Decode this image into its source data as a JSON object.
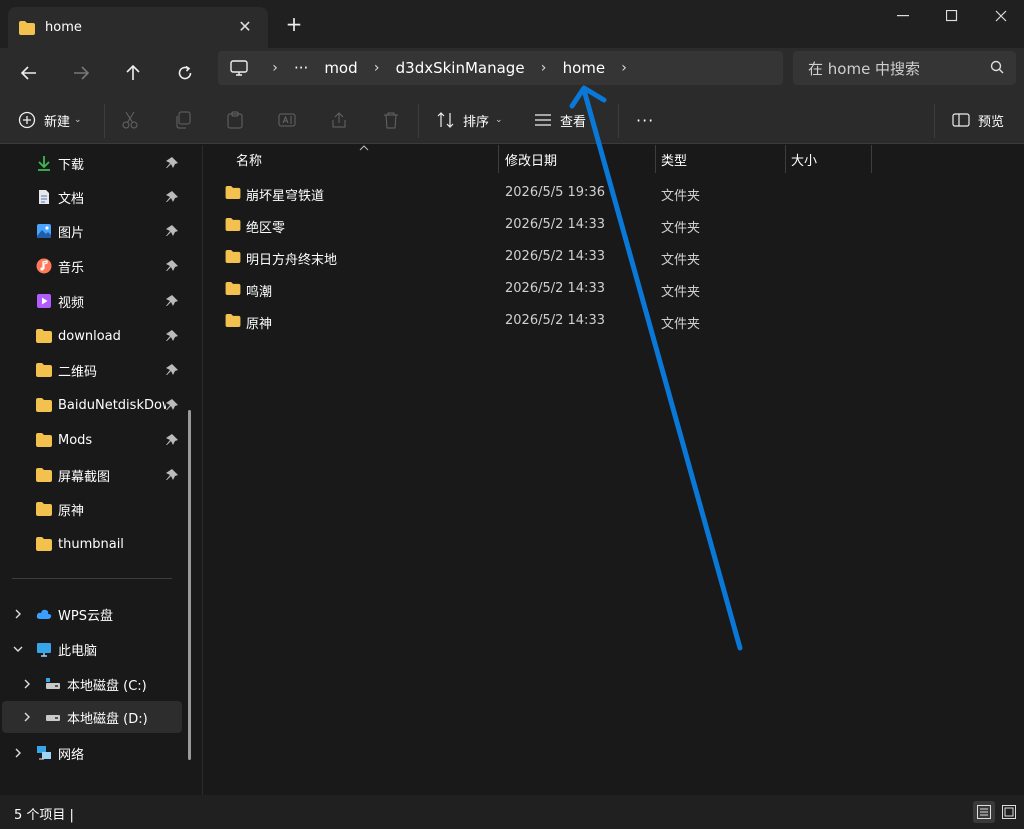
{
  "tab": {
    "title": "home",
    "close_icon": "close-icon",
    "new_tab_icon": "plus-icon"
  },
  "window": {
    "minimize": "minimize-icon",
    "maximize": "maximize-icon",
    "close": "close-icon"
  },
  "nav": {
    "back": "back-arrow-icon",
    "forward": "forward-arrow-icon",
    "up": "up-arrow-icon",
    "refresh": "refresh-icon"
  },
  "breadcrumb": {
    "root_icon": "monitor-icon",
    "ellipsis": "···",
    "items": [
      "mod",
      "d3dxSkinManage",
      "home"
    ]
  },
  "search": {
    "placeholder": "在 home 中搜索"
  },
  "toolbar": {
    "new_label": "新建",
    "sort_label": "排序",
    "view_label": "查看",
    "more": "···",
    "preview_label": "预览"
  },
  "sidebar": {
    "quick_access": [
      {
        "label": "下载",
        "icon": "download-icon",
        "color": "#3fb950"
      },
      {
        "label": "文档",
        "icon": "document-icon",
        "color": "#e0e0e0"
      },
      {
        "label": "图片",
        "icon": "picture-icon",
        "color": "#4aa3ff"
      },
      {
        "label": "音乐",
        "icon": "music-icon",
        "color": "#ff7a59"
      },
      {
        "label": "视频",
        "icon": "video-icon",
        "color": "#b05cff"
      },
      {
        "label": "download",
        "icon": "folder-icon",
        "color": "#f2c14e"
      },
      {
        "label": "二维码",
        "icon": "folder-icon",
        "color": "#f2c14e"
      },
      {
        "label": "BaiduNetdiskDownload",
        "icon": "folder-icon",
        "color": "#f2c14e"
      },
      {
        "label": "Mods",
        "icon": "folder-icon",
        "color": "#f2c14e"
      },
      {
        "label": "屏幕截图",
        "icon": "folder-icon",
        "color": "#f2c14e"
      },
      {
        "label": "原神",
        "icon": "folder-icon",
        "color": "#f2c14e"
      },
      {
        "label": "thumbnail",
        "icon": "folder-icon",
        "color": "#f2c14e"
      }
    ],
    "locations": [
      {
        "label": "WPS云盘",
        "icon": "cloud-icon"
      },
      {
        "label": "此电脑",
        "icon": "pc-icon"
      },
      {
        "label": "本地磁盘 (C:)",
        "icon": "drive-icon"
      },
      {
        "label": "本地磁盘 (D:)",
        "icon": "drive-icon"
      },
      {
        "label": "网络",
        "icon": "network-icon"
      }
    ]
  },
  "columns": {
    "name": "名称",
    "date": "修改日期",
    "type": "类型",
    "size": "大小"
  },
  "files": [
    {
      "name": "崩坏星穹铁道",
      "date": "2026/5/5 19:36",
      "type": "文件夹"
    },
    {
      "name": "绝区零",
      "date": "2026/5/2 14:33",
      "type": "文件夹"
    },
    {
      "name": "明日方舟终末地",
      "date": "2026/5/2 14:33",
      "type": "文件夹"
    },
    {
      "name": "鸣潮",
      "date": "2026/5/2 14:33",
      "type": "文件夹"
    },
    {
      "name": "原神",
      "date": "2026/5/2 14:33",
      "type": "文件夹"
    }
  ],
  "status": {
    "text": "5 个项目  |"
  },
  "colors": {
    "accent": "#0a78d7",
    "folder": "#f2c14e"
  }
}
